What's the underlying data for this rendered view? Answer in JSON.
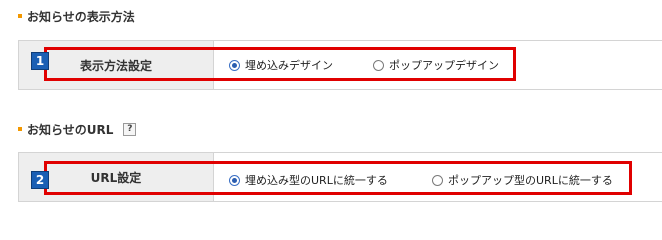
{
  "section1": {
    "heading": "お知らせの表示方法",
    "badge": "1",
    "label": "表示方法設定",
    "options": [
      {
        "label": "埋め込みデザイン",
        "checked": true
      },
      {
        "label": "ポップアップデザイン",
        "checked": false
      }
    ]
  },
  "section2": {
    "heading": "お知らせのURL",
    "help_icon": "?",
    "badge": "2",
    "label": "URL設定",
    "options": [
      {
        "label": "埋め込み型のURLに統一する",
        "checked": true
      },
      {
        "label": "ポップアップ型のURLに統一する",
        "checked": false
      }
    ]
  },
  "colors": {
    "bullet": "#f39800",
    "badge": "#1a5fb4",
    "highlight": "#e00000",
    "label_bg": "#eeeeee"
  }
}
